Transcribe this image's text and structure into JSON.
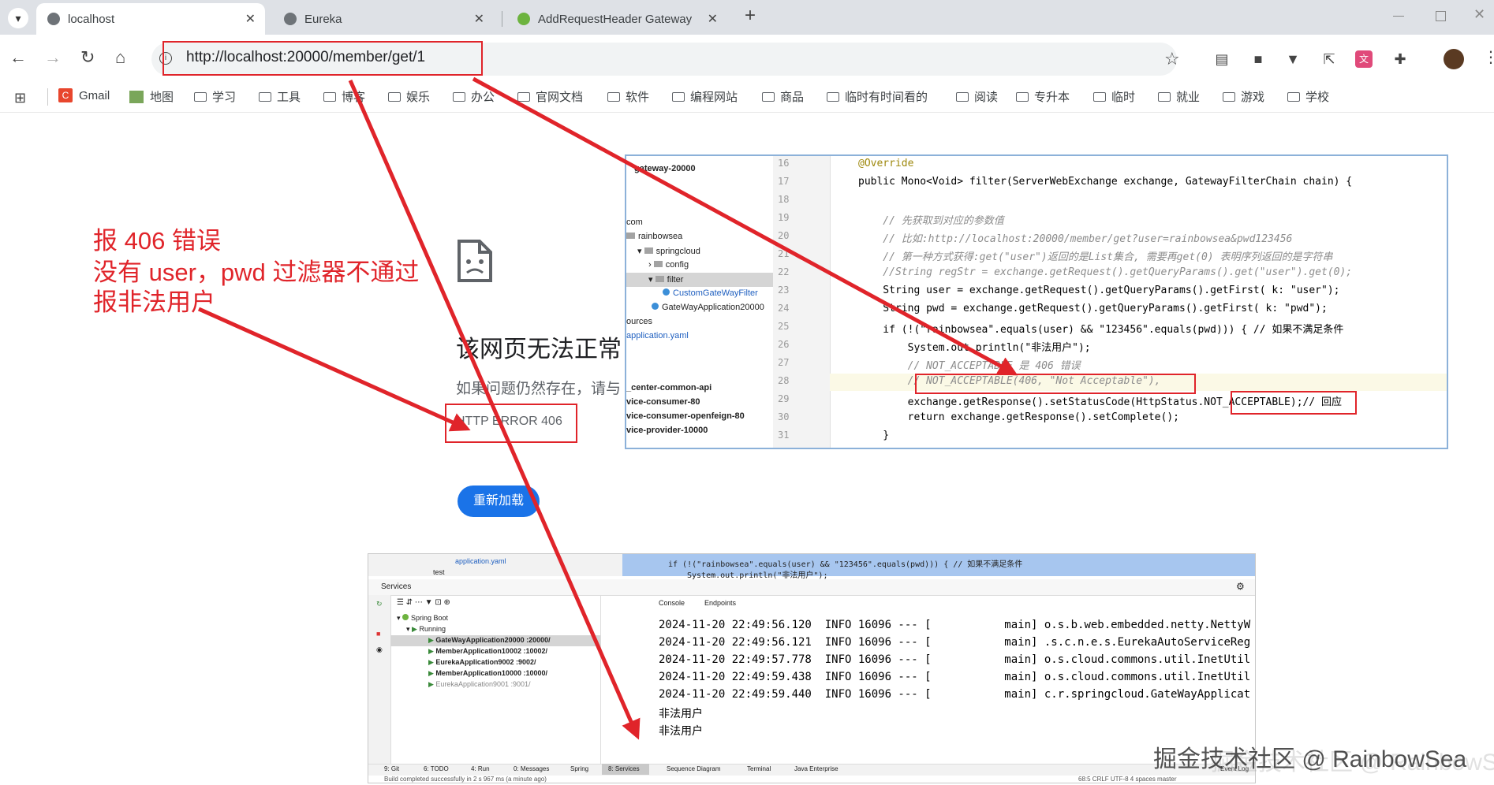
{
  "browser": {
    "tabs": [
      {
        "title": "localhost",
        "active": true
      },
      {
        "title": "Eureka",
        "active": false
      },
      {
        "title": "AddRequestHeader Gateway",
        "active": false
      }
    ],
    "new_tab": "+",
    "url": "http://localhost:20000/member/get/1",
    "bookmarks": [
      "Gmail",
      "地图",
      "学习",
      "工具",
      "博客",
      "娱乐",
      "办公",
      "官网文档",
      "软件",
      "编程网站",
      "商品",
      "临时有时间看的",
      "阅读",
      "专升本",
      "临时",
      "就业",
      "游戏",
      "学校"
    ]
  },
  "error_page": {
    "title": "该网页无法正常",
    "desc": "如果问题仍然存在，请与",
    "code": "HTTP ERROR 406",
    "reload": "重新加载"
  },
  "annotation": {
    "line1": "报 406 错误",
    "line2": "没有 user，pwd 过滤器不通过",
    "line3": "报非法用户"
  },
  "project_tree": [
    "gateway-20000",
    "com",
    "rainbowsea",
    "springcloud",
    "config",
    "filter",
    "CustomGateWayFilter",
    "GateWayApplication20000",
    "ources",
    "application.yaml",
    "_center-common-api",
    "vice-consumer-80",
    "vice-consumer-openfeign-80",
    "vice-provider-10000"
  ],
  "code": {
    "line_numbers": [
      "16",
      "17",
      "18",
      "19",
      "20",
      "21",
      "22",
      "23",
      "24",
      "25",
      "26",
      "27",
      "28",
      "29",
      "30",
      "31"
    ],
    "lines": [
      "@Override",
      "public Mono<Void> filter(ServerWebExchange exchange, GatewayFilterChain chain) {",
      "",
      "    // 先获取到对应的参数值",
      "    // 比如:http://localhost:20000/member/get?user=rainbowsea&pwd123456",
      "    // 第一种方式获得:get(\"user\")返回的是List集合, 需要再get(0) 表明序列返回的是字符串",
      "    //String regStr = exchange.getRequest().getQueryParams().get(\"user\").get(0);",
      "    String user = exchange.getRequest().getQueryParams().getFirst( k: \"user\");",
      "    String pwd = exchange.getRequest().getQueryParams().getFirst( k: \"pwd\");",
      "    if (!(\"rainbowsea\".equals(user) && \"123456\".equals(pwd))) { // 如果不满足条件",
      "        System.out.println(\"非法用户\");",
      "        // NOT_ACCEPTABLE 是 406 错误",
      "        // NOT_ACCEPTABLE(406, \"Not Acceptable\"),",
      "        exchange.getResponse().setStatusCode(HttpStatus.NOT_ACCEPTABLE);// 回应",
      "        return exchange.getResponse().setComplete();",
      "    }"
    ]
  },
  "ide": {
    "top_line": "if (!(\"rainbowsea\".equals(user) && \"123456\".equals(pwd))) { // 如果不满足条件",
    "top_line2": "System.out.println(\"非法用户\");",
    "tree_top": [
      "application.yaml",
      "test"
    ],
    "services_title": "Services",
    "console_tabs": [
      "Console",
      "Endpoints"
    ],
    "services": [
      "Spring Boot",
      "Running",
      "GateWayApplication20000 :20000/",
      "MemberApplication10002 :10002/",
      "EurekaApplication9002 :9002/",
      "MemberApplication10000 :10000/",
      "EurekaApplication9001 :9001/"
    ],
    "logs": [
      "2024-11-20 22:49:56.120  INFO 16096 --- [           main] o.s.b.web.embedded.netty.NettyW",
      "2024-11-20 22:49:56.121  INFO 16096 --- [           main] .s.c.n.e.s.EurekaAutoServiceReg",
      "2024-11-20 22:49:57.778  INFO 16096 --- [           main] o.s.cloud.commons.util.InetUtil",
      "2024-11-20 22:49:59.438  INFO 16096 --- [           main] o.s.cloud.commons.util.InetUtil",
      "2024-11-20 22:49:59.440  INFO 16096 --- [           main] c.r.springcloud.GateWayApplicat"
    ],
    "output": [
      "非法用户",
      "非法用户"
    ],
    "bottom_tabs": [
      "9: Git",
      "6: TODO",
      "4: Run",
      "0: Messages",
      "Spring",
      "8: Services",
      "Sequence Diagram",
      "Terminal",
      "Java Enterprise",
      "Event Log"
    ],
    "status": "Build completed successfully in 2 s 967 ms (a minute ago)",
    "status_right": "68:5   CRLF   UTF-8   4 spaces   master"
  },
  "watermark": "掘金技术社区 @ RainbowSea",
  "colors": {
    "annotation_red": "#e0242a",
    "reload_blue": "#1a73e8"
  }
}
